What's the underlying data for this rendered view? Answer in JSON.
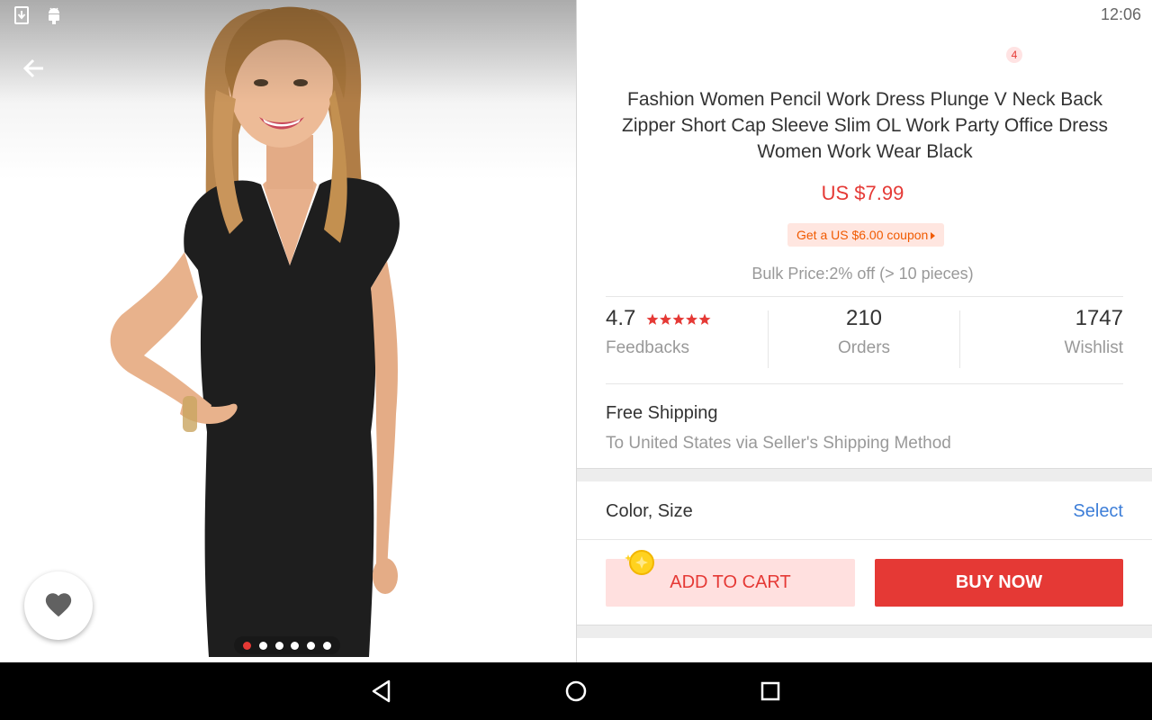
{
  "status_bar": {
    "time": "12:06"
  },
  "product": {
    "title": "Fashion Women Pencil Work Dress Plunge V Neck Back Zipper Short Cap Sleeve Slim OL Work Party Office Dress Women Work Wear Black",
    "price": "US $7.99",
    "coupon": "Get a US $6.00 coupon",
    "bulk_price": "Bulk Price:2% off (> 10 pieces)",
    "image_count": 6,
    "active_image": 1
  },
  "stats": {
    "rating": "4.7",
    "rating_stars": 5,
    "feedbacks_label": "Feedbacks",
    "orders": "210",
    "orders_label": "Orders",
    "wishlist": "1747",
    "wishlist_label": "Wishlist"
  },
  "shipping": {
    "title": "Free Shipping",
    "subtitle": "To United States via Seller's Shipping Method"
  },
  "variant": {
    "label": "Color, Size",
    "action": "Select"
  },
  "actions": {
    "add_to_cart": "ADD TO CART",
    "buy_now": "BUY NOW"
  },
  "toolbar": {
    "cart_count": "4"
  },
  "colors": {
    "accent": "#e53935",
    "link": "#3d7ed8",
    "coupon": "#f05a00"
  },
  "icons": [
    "back-arrow-icon",
    "search-icon",
    "cart-icon",
    "share-icon",
    "more-vert-icon",
    "heart-icon",
    "wifi-icon",
    "battery-icon",
    "download-icon",
    "android-icon",
    "nav-back-icon",
    "nav-home-icon",
    "nav-recents-icon"
  ]
}
